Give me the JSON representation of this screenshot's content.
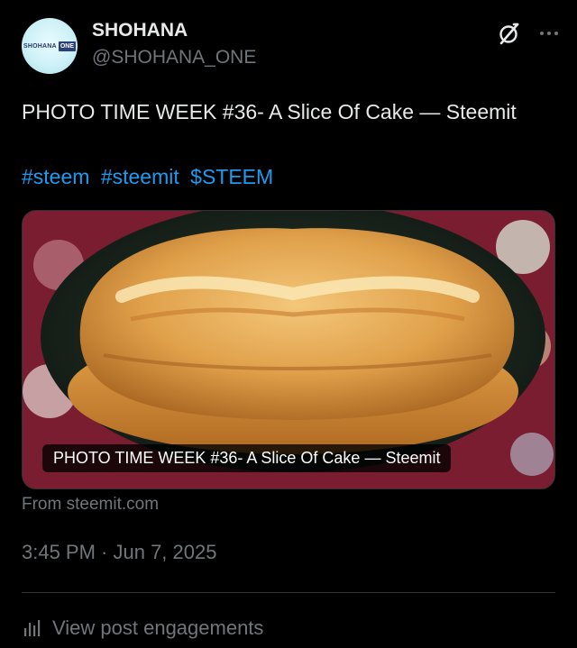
{
  "author": {
    "display_name": "SHOHANA",
    "handle": "@SHOHANA_ONE",
    "avatar_text": "SHOHANA",
    "avatar_badge": "ONE"
  },
  "icons": {
    "grok": "grok-icon",
    "more": "more-options-icon",
    "engagements": "bar-chart-icon"
  },
  "post": {
    "text": "PHOTO TIME WEEK #36- A Slice Of Cake — Steemit",
    "hashtags": [
      "#steem",
      "#steemit",
      "$STEEM"
    ]
  },
  "card": {
    "title": "PHOTO TIME WEEK #36- A Slice Of Cake — Steemit",
    "source": "From steemit.com"
  },
  "meta": {
    "timestamp": "3:45 PM · Jun 7, 2025",
    "engagements_label": "View post engagements"
  },
  "colors": {
    "background": "#000000",
    "text_primary": "#e7e9ea",
    "text_secondary": "#71767b",
    "link": "#1d9bf0",
    "divider": "#2f3336"
  }
}
